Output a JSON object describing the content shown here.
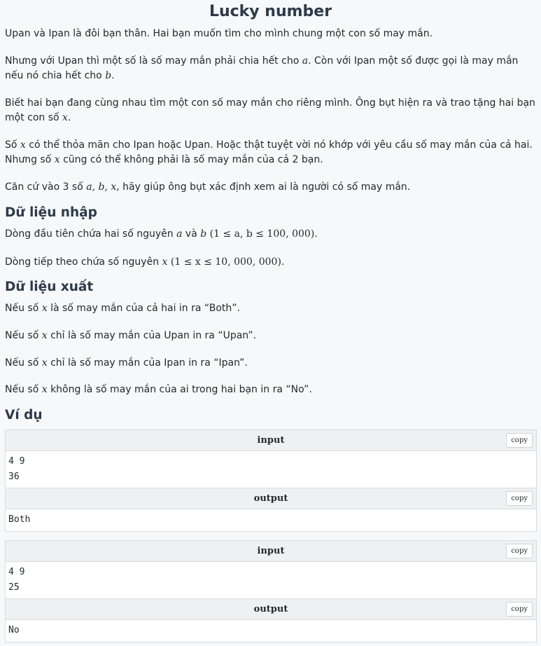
{
  "title": "Lucky number",
  "paragraphs": {
    "p1": "Upan và Ipan là đôi bạn thân. Hai bạn muốn tìm cho mình chung một con số may mắn.",
    "p2a": "Nhưng với Upan thì một số là số may mắn phải chia hết cho ",
    "p2b": ". Còn với Ipan một số được gọi là may mắn nếu nó chia hết cho ",
    "p3a": "Biết hai bạn đang cùng nhau tìm một con số may mắn cho riêng mình. Ông bụt hiện ra và trao tặng hai bạn một con số ",
    "p4a": "Số ",
    "p4b": " có thể thỏa mãn cho Ipan hoặc Upan. Hoặc thật tuyệt vời nó khớp với yêu cầu số may mắn của cả hai. Nhưng số ",
    "p4c": " cũng có thể không phải là số may mắn của cả 2 bạn.",
    "p5a": "Căn cứ vào 3 số ",
    "p5b": ", hãy giúp ông bụt xác định xem ai là người có số may mắn."
  },
  "math": {
    "a": "a",
    "b": "b",
    "x": "x",
    "abx": "a, b, x",
    "range_ab": "(1 ≤ a, b ≤ 100, 000)",
    "range_x": "(1 ≤ x ≤ 10, 000, 000)"
  },
  "input_section": {
    "heading": "Dữ liệu nhập",
    "line1a": "Dòng đầu tiên chứa hai số nguyên ",
    "line1b": " và ",
    "line2a": "Dòng tiếp theo chứa số nguyên "
  },
  "output_section": {
    "heading": "Dữ liệu xuất",
    "o1a": "Nếu số ",
    "o1b": " là số may mắn của cả hai in ra “Both”.",
    "o2a": "Nếu số ",
    "o2b": " chỉ là số may mắn của Upan in ra “Upan”.",
    "o3a": "Nếu số ",
    "o3b": " chỉ là số may mắn của Ipan in ra “Ipan”.",
    "o4a": "Nếu số ",
    "o4b": " không là số may mắn của ai trong hai bạn in ra “No”."
  },
  "examples_heading": "Ví dụ",
  "examples": [
    {
      "input_label": "input",
      "output_label": "output",
      "copy_label": "copy",
      "input": "4 9\n36",
      "output": "Both"
    },
    {
      "input_label": "input",
      "output_label": "output",
      "copy_label": "copy",
      "input": "4 9\n25",
      "output": "No"
    }
  ]
}
